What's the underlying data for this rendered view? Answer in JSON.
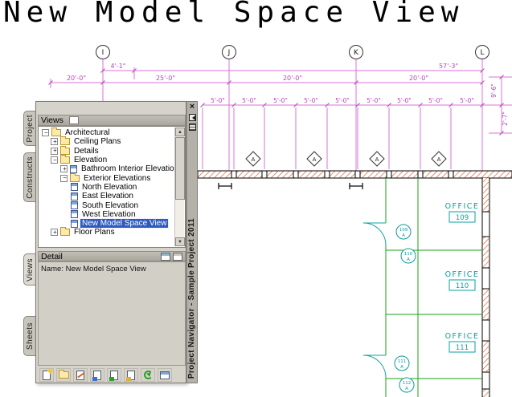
{
  "title": "New Model Space View",
  "drawing": {
    "grid_labels": [
      "I",
      "J",
      "K",
      "L"
    ],
    "dim_row1": [
      "4'-1\"",
      "57'-3\""
    ],
    "dim_row2": [
      "20'-0\"",
      "25'-0\"",
      "20'-0\"",
      "20'-0\""
    ],
    "dim_row3": [
      "5'-0\"",
      "5'-0\"",
      "5'-0\"",
      "5'-0\"",
      "5'-0\"",
      "5'-0\"",
      "5'-0\"",
      "5'-0\"",
      "5'-0\""
    ],
    "dim_right": [
      "9'-6\"",
      "2'-7\""
    ],
    "window_tags": [
      "A",
      "A",
      "A",
      "A"
    ],
    "rooms": [
      {
        "name": "OFFICE",
        "number": "109"
      },
      {
        "name": "OFFICE",
        "number": "110"
      },
      {
        "name": "OFFICE",
        "number": "111"
      }
    ],
    "door_tags": [
      {
        "number": "109",
        "letter": "A"
      },
      {
        "number": "110",
        "letter": "A"
      },
      {
        "number": "111",
        "letter": "A"
      },
      {
        "number": "112",
        "letter": "A"
      }
    ]
  },
  "palette": {
    "title_vertical": "Project Navigator - Sample Project 2011",
    "side_tabs": [
      {
        "label": "Project"
      },
      {
        "label": "Constructs"
      },
      {
        "label": "Views"
      },
      {
        "label": "Sheets"
      }
    ],
    "views_header": "Views",
    "detail_header": "Detail",
    "detail_text": "Name: New Model Space View",
    "tree": [
      {
        "label": "Architectural"
      },
      {
        "label": "Ceiling Plans"
      },
      {
        "label": "Details"
      },
      {
        "label": "Elevation"
      },
      {
        "label": "Bathroom Interior Elevations"
      },
      {
        "label": "Exterior Elevations"
      },
      {
        "label": "North Elevation"
      },
      {
        "label": "East Elevation"
      },
      {
        "label": "South Elevation"
      },
      {
        "label": "West Elevation"
      },
      {
        "label": "New Model Space View",
        "selected": true
      },
      {
        "label": "Floor Plans"
      }
    ]
  },
  "colors": {
    "dimension_magenta": "#d973d9",
    "dimension_text": "#b448b4",
    "wall_hatch_orange": "#e0561e",
    "annotation_cyan": "#0aa0a0",
    "partition_green": "#1aa01a",
    "selection_blue": "#2f5bc0"
  }
}
